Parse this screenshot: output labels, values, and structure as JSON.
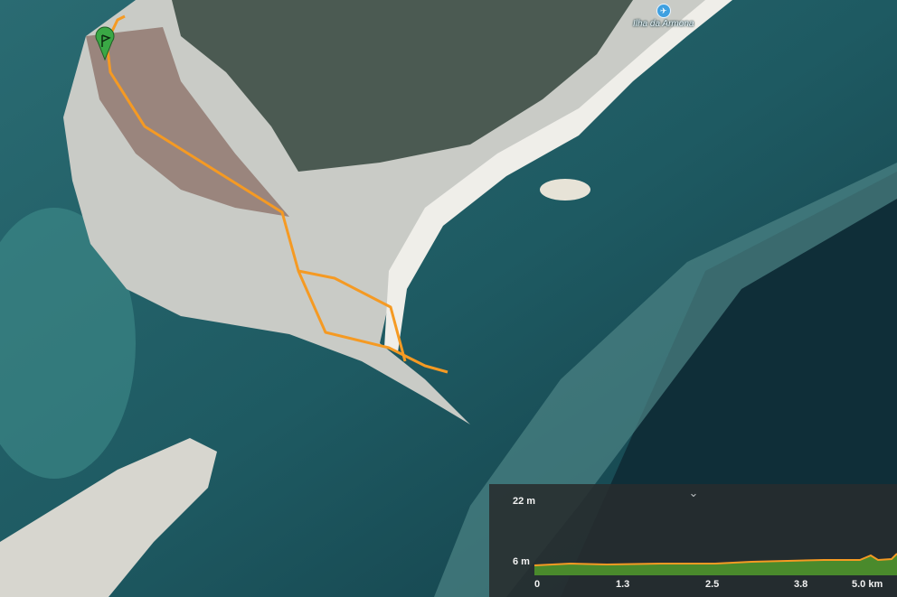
{
  "map": {
    "place_label": "Ilha da Armona",
    "poi_icon": "airplane-icon",
    "route_color": "#f59a23",
    "marker_color": "#3aa845",
    "marker_icon": "flag-icon"
  },
  "elevation": {
    "max_label": "22 m",
    "min_label": "6 m",
    "collapse_icon": "chevron-down-icon",
    "x_ticks": [
      "0",
      "1.3",
      "2.5",
      "3.8",
      "5.0 km"
    ],
    "profile_fill": "#4a8a2c",
    "profile_line": "#f59a23"
  }
}
